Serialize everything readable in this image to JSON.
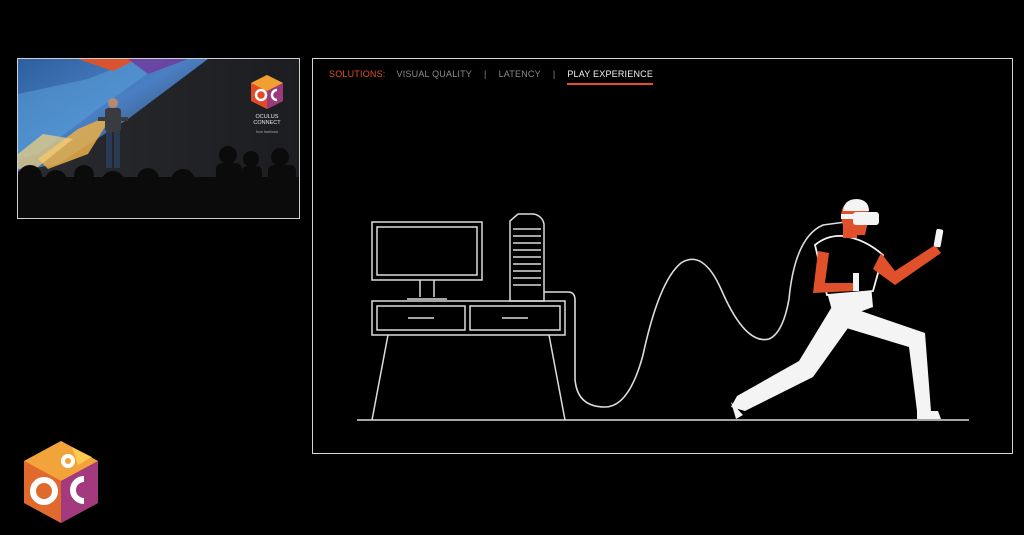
{
  "nav": {
    "lead": "SOLUTIONS:",
    "items": [
      "VISUAL QUALITY",
      "LATENCY",
      "PLAY EXPERIENCE"
    ],
    "separator": "|",
    "active_index": 2
  },
  "camera_feed": {
    "logo_text": [
      "OCULUS",
      "CONNECT"
    ],
    "sub_text": "from facebook"
  },
  "colors": {
    "background": "#000000",
    "accent": "#e0502a",
    "active_nav": "#f2f2f2",
    "inactive_nav": "#8c8c8c",
    "frame_border": "#d4d4d4"
  },
  "icons": [
    "oculus-connect-logo-icon",
    "desktop-pc-icon",
    "vr-player-icon"
  ]
}
